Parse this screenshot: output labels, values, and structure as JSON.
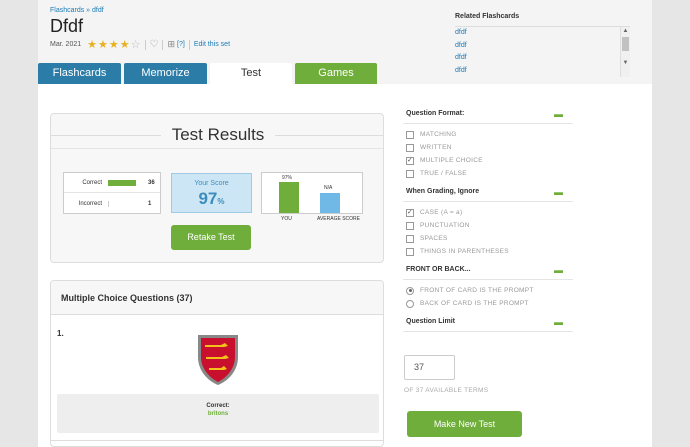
{
  "breadcrumb": "Flashcards » dfdf",
  "title": "Dfdf",
  "meta": {
    "date": "Mar. 2021",
    "rating": 4.5,
    "folder_count": "[?]",
    "edit_label": "Edit this set"
  },
  "related": {
    "heading": "Related Flashcards",
    "items": [
      "dfdf",
      "dfdf",
      "dfdf",
      "dfdf"
    ]
  },
  "tabs": [
    {
      "label": "Flashcards"
    },
    {
      "label": "Memorize"
    },
    {
      "label": "Test"
    },
    {
      "label": "Games"
    }
  ],
  "results": {
    "title": "Test Results",
    "correct_label": "Correct",
    "correct_value": "36",
    "incorrect_label": "Incorrect",
    "incorrect_value": "1",
    "your_score_label": "Your Score",
    "your_score_value": "97",
    "your_score_unit": "%",
    "compare_you_value": "97%",
    "compare_avg_value": "N/A",
    "compare_you_label": "YOU",
    "compare_avg_label": "AVERAGE SCORE",
    "retake_label": "Retake Test"
  },
  "mc": {
    "header": "Multiple Choice Questions (37)",
    "question_number": "1.",
    "correct_label": "Correct:",
    "correct_answer": "britons"
  },
  "options": {
    "format": {
      "heading": "Question Format:",
      "collapse": "▬",
      "items": [
        {
          "label": "MATCHING",
          "checked": ""
        },
        {
          "label": "WRITTEN",
          "checked": ""
        },
        {
          "label": "MULTIPLE CHOICE",
          "checked": "✓"
        },
        {
          "label": "TRUE / FALSE",
          "checked": ""
        }
      ]
    },
    "grading": {
      "heading": "When Grading, Ignore",
      "collapse": "▬",
      "items": [
        {
          "label": "CASE (A = a)",
          "checked": "✓"
        },
        {
          "label": "PUNCTUATION",
          "checked": ""
        },
        {
          "label": "SPACES",
          "checked": ""
        },
        {
          "label": "THINGS IN PARENTHESES",
          "checked": ""
        }
      ]
    },
    "front_back": {
      "heading": "FRONT OR BACK...",
      "collapse": "▬",
      "items": [
        {
          "label": "FRONT OF CARD IS THE PROMPT"
        },
        {
          "label": "BACK OF CARD IS THE PROMPT"
        }
      ]
    },
    "limit": {
      "heading": "Question Limit",
      "collapse": "▬",
      "value": "37",
      "caption": "OF 37 AVAILABLE TERMS"
    },
    "make_label": "Make New Test"
  },
  "colors": {
    "green": "#6fae3a",
    "blue": "#2b7da8",
    "link": "#1a7bb9"
  }
}
